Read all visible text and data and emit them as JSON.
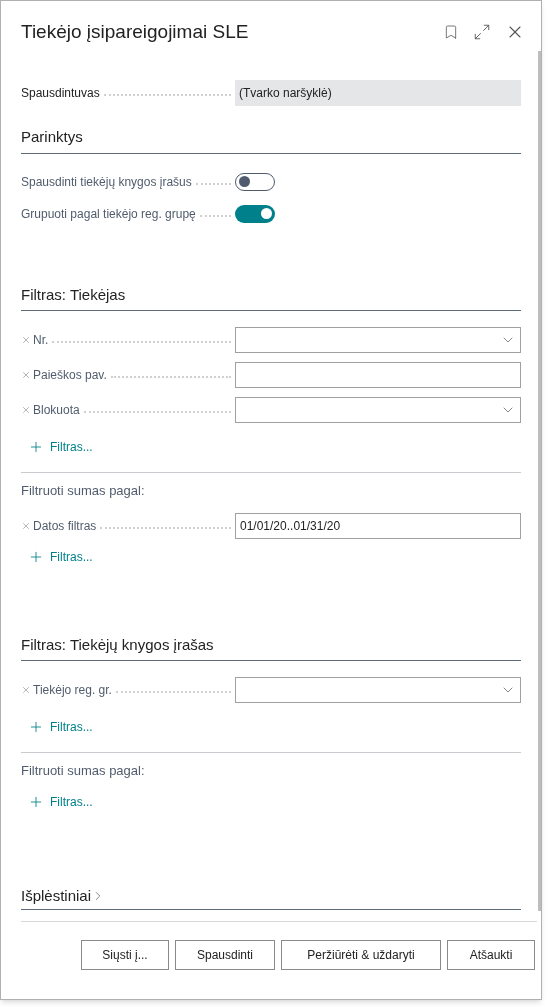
{
  "window": {
    "title": "Tiekėjo įsipareigojimai SLE"
  },
  "printer": {
    "label": "Spausdintuvas",
    "value": "(Tvarko naršyklė)"
  },
  "options": {
    "title": "Parinktys",
    "items": [
      {
        "label": "Spausdinti tiekėjų knygos įrašus",
        "on": false
      },
      {
        "label": "Grupuoti pagal tiekėjo reg. grupę",
        "on": true
      }
    ]
  },
  "filters": [
    {
      "title": "Filtras: Tiekėjas",
      "fields": [
        {
          "label": "Nr.",
          "kind": "dropdown"
        },
        {
          "label": "Paieškos pav.",
          "kind": "text"
        },
        {
          "label": "Blokuota",
          "kind": "dropdown"
        }
      ],
      "add_filter": "Filtras...",
      "totals": {
        "title": "Filtruoti sumas pagal:",
        "fields": [
          {
            "label": "Datos filtras",
            "kind": "text",
            "value": "01/01/20..01/31/20"
          }
        ],
        "add_filter": "Filtras..."
      }
    },
    {
      "title": "Filtras: Tiekėjų knygos įrašas",
      "fields": [
        {
          "label": "Tiekėjo reg. gr.",
          "kind": "dropdown"
        }
      ],
      "add_filter": "Filtras...",
      "totals": {
        "title": "Filtruoti sumas pagal:",
        "add_filter": "Filtras..."
      }
    }
  ],
  "advanced": {
    "title": "Išplėstiniai"
  },
  "buttons": [
    "Siųsti į...",
    "Spausdinti",
    "Peržiūrėti & uždaryti",
    "Atšaukti"
  ]
}
